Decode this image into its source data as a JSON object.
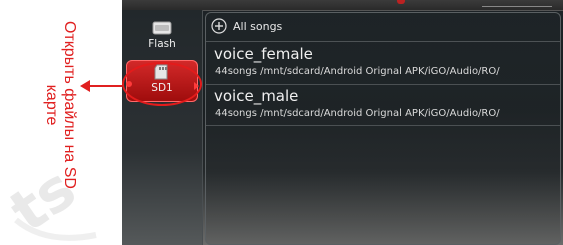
{
  "annotation": {
    "text": "Открыть файлы на SD карте",
    "color": "#e02020"
  },
  "sidebar": {
    "items": [
      {
        "label": "Flash",
        "icon": "flash-storage-icon",
        "selected": false
      },
      {
        "label": "SD1",
        "icon": "sd-card-icon",
        "selected": true
      }
    ],
    "selected_color": "#c01818"
  },
  "list": {
    "header_label": "All songs",
    "header_icon": "plus-circle-icon",
    "items": [
      {
        "name": "voice_female",
        "subtitle": "44songs /mnt/sdcard/Android Orignal APK/iGO/Audio/RO/"
      },
      {
        "name": "voice_male",
        "subtitle": "44songs /mnt/sdcard/Android Orignal APK/iGO/Audio/RO/"
      }
    ]
  }
}
